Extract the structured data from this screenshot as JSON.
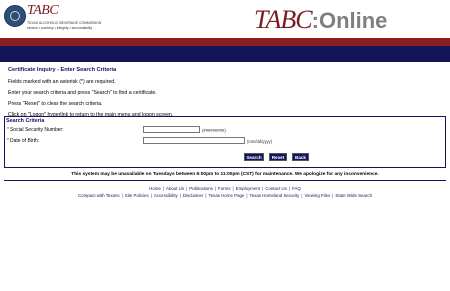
{
  "header": {
    "logo_small": "TABC",
    "logo_sub1": "TEXAS ALCOHOLIC BEVERAGE COMMISSION",
    "logo_sub2": "service • courtesy • integrity • accountability",
    "brand_tabc": "TABC",
    "brand_online": ":Online"
  },
  "colors": {
    "maroon": "#8b1d24",
    "navy": "#14145a",
    "grey_text": "#7f7f7f"
  },
  "page": {
    "title": "Certificate Inquiry - Enter Search Criteria",
    "instructions": [
      "Fields marked with an asterisk (*) are required.",
      "Enter your search criteria and press \"Search\" to find a certificate.",
      "Press \"Reset\" to clear the search criteria.",
      "Click on \"Logon\" hyperlink to return to the main menu and logon screen."
    ]
  },
  "search": {
    "panel_title": "Search Criteria",
    "ssn_label": "Social Security Number:",
    "ssn_value": "",
    "ssn_format": "(#########)",
    "dob_label": "Date of Birth:",
    "dob_value": "",
    "dob_format": "(mm/dd/yyyy)",
    "required_marker": "*",
    "buttons": {
      "search": "Search",
      "reset": "Reset",
      "back": "Back"
    }
  },
  "maintenance_notice": "This system may be unavailable on Tuesdays between 6:00pm to 11:00pm (CST) for maintenance. We apologize for any inconvenience.",
  "footer": {
    "links_row1": [
      "Home",
      "About Us",
      "Publications",
      "Forms",
      "Employment",
      "Contact Us",
      "FAQ"
    ],
    "links_row2": [
      "Compact with Texans",
      "Site Policies",
      "Accessibility",
      "Disclaimer",
      "Texas Home Page",
      "Texas Homeland Security",
      "Viewing Files",
      "State Wide Search"
    ]
  }
}
